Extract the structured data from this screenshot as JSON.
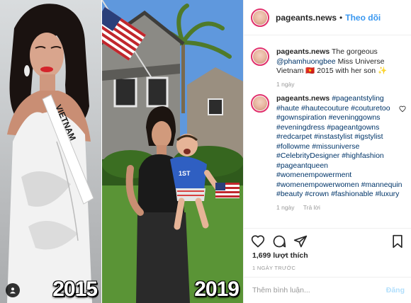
{
  "photos": {
    "left_year": "2015",
    "right_year": "2019",
    "sash_text": "VIETNAM"
  },
  "header": {
    "username": "pageants.news",
    "separator": "•",
    "follow_label": "Theo dõi"
  },
  "caption": {
    "username": "pageants.news",
    "text_before": "The gorgeous",
    "mention": "@phamhuongbee",
    "text_after": "Miss Universe Vietnam 🇻🇳 2015 with her son ✨",
    "age": "1 ngày"
  },
  "hashtag_comment": {
    "username": "pageants.news",
    "tags": [
      "#pageantstyling",
      "#haute",
      "#hautecouture",
      "#couturetoo",
      "#gownspiration",
      "#eveninggowns",
      "#eveningdress",
      "#pageantgowns",
      "#redcarpet",
      "#instastylist",
      "#igstylist",
      "#followme",
      "#missuniverse",
      "#CelebrityDesigner",
      "#highfashion",
      "#pageantqueen",
      "#womenempowerment",
      "#womenempowerwomen",
      "#mannequin",
      "#beauty",
      "#crown",
      "#fashionable",
      "#luxury"
    ],
    "age": "1 ngày",
    "reply_label": "Trả lời"
  },
  "actions": {
    "like_icon": "heart-icon",
    "comment_icon": "comment-icon",
    "share_icon": "share-icon",
    "save_icon": "bookmark-icon"
  },
  "likes": "1,699 lượt thích",
  "timestamp": "1 NGÀY TRƯỚC",
  "comment_box": {
    "placeholder": "Thêm bình luận...",
    "post_label": "Đăng"
  },
  "colors": {
    "link": "#003569",
    "follow": "#3897f0",
    "post_disabled": "#b2dffc",
    "muted": "#999999"
  }
}
